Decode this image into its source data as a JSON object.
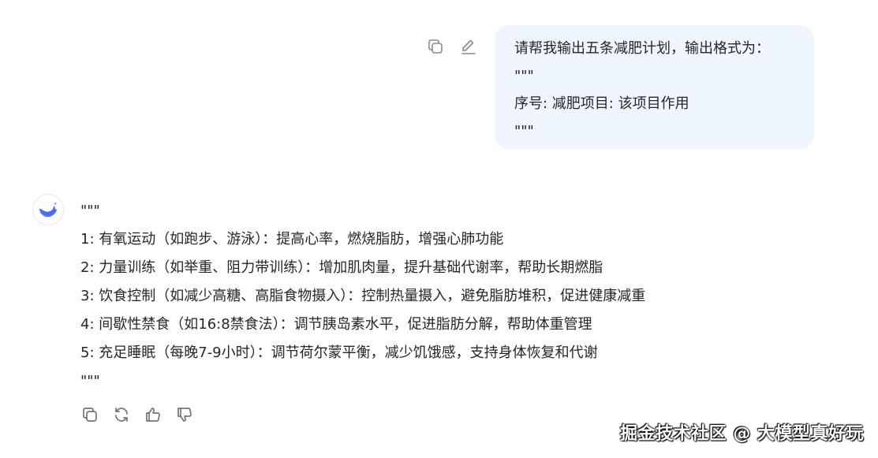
{
  "user_message": {
    "lines": [
      "请帮我输出五条减肥计划，输出格式为：",
      "\"\"\"",
      "序号: 减肥项目: 该项目作用",
      "\"\"\""
    ]
  },
  "user_actions": {
    "copy_icon": "copy-icon",
    "edit_icon": "edit-icon"
  },
  "assistant": {
    "avatar_icon": "whale-logo-icon",
    "lines": [
      "\"\"\"",
      "1: 有氧运动（如跑步、游泳）：提高心率，燃烧脂肪，增强心肺功能",
      "2: 力量训练（如举重、阻力带训练）：增加肌肉量，提升基础代谢率，帮助长期燃脂",
      "3: 饮食控制（如减少高糖、高脂食物摄入）：控制热量摄入，避免脂肪堆积，促进健康减重",
      "4: 间歇性禁食（如16:8禁食法）：调节胰岛素水平，促进脂肪分解，帮助体重管理",
      "5: 充足睡眠（每晚7-9小时）：调节荷尔蒙平衡，减少饥饿感，支持身体恢复和代谢",
      "\"\"\""
    ]
  },
  "answer_actions": [
    "copy-icon",
    "regenerate-icon",
    "thumbs-up-icon",
    "thumbs-down-icon"
  ],
  "watermark": "掘金技术社区 @ 大模型真好玩",
  "colors": {
    "bubble_bg": "#eff6ff",
    "text": "#262626",
    "icon": "#8a8a8a",
    "avatar": "#4d6bfe"
  }
}
